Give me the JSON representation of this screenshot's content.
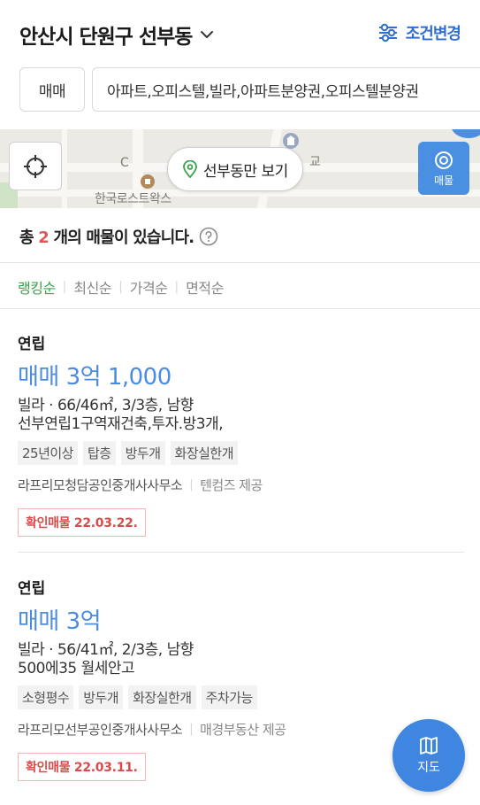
{
  "header": {
    "region": "안산시 단원구 선부동",
    "filter_label": "조건변경"
  },
  "filters": {
    "trade_type": "매매",
    "property_types": "아파트,오피스텔,빌라,아파트분양권,오피스텔분양권"
  },
  "map": {
    "labels": [
      "한국로스트왁스",
      "교",
      "C"
    ],
    "only_area_button": "선부동만 보기",
    "listing_button": "매물"
  },
  "summary": {
    "prefix": "총",
    "count": "2",
    "suffix": "개의 매물이 있습니다."
  },
  "sort": {
    "options": [
      "랭킹순",
      "최신순",
      "가격순",
      "면적순"
    ],
    "active": "랭킹순"
  },
  "listings": [
    {
      "type": "연립",
      "price": "매매 3억 1,000",
      "spec": "빌라 · 66/46㎡, 3/3층, 남향",
      "description": "선부연립1구역재건축,투자.방3개,",
      "tags": [
        "25년이상",
        "탑층",
        "방두개",
        "화장실한개"
      ],
      "agency": "라프리모청담공인중개사사무소",
      "provider": "텐컴즈 제공",
      "confirmed": "확인매물 22.03.22."
    },
    {
      "type": "연립",
      "price": "매매 3억",
      "spec": "빌라 · 56/41㎡, 2/3층, 남향",
      "description": "500에35 월세안고",
      "tags": [
        "소형평수",
        "방두개",
        "화장실한개",
        "주차가능"
      ],
      "agency": "라프리모선부공인중개사사무소",
      "provider": "매경부동산 제공",
      "confirmed": "확인매물 22.03.11."
    }
  ],
  "fab": {
    "label": "지도"
  },
  "colors": {
    "accent_blue": "#2f6fd0",
    "price_blue": "#4a8de0",
    "active_green": "#3aa34a",
    "count_red": "#e05555",
    "confirm_red": "#d94b4b",
    "fab_blue": "#3e86e0"
  },
  "icons": {
    "region_dropdown": "chevron-down-icon",
    "filter": "sliders-icon",
    "locate": "crosshair-icon",
    "only_area": "location-pin-icon",
    "listing": "target-icon",
    "help": "question-circle-icon",
    "fab": "map-icon"
  }
}
